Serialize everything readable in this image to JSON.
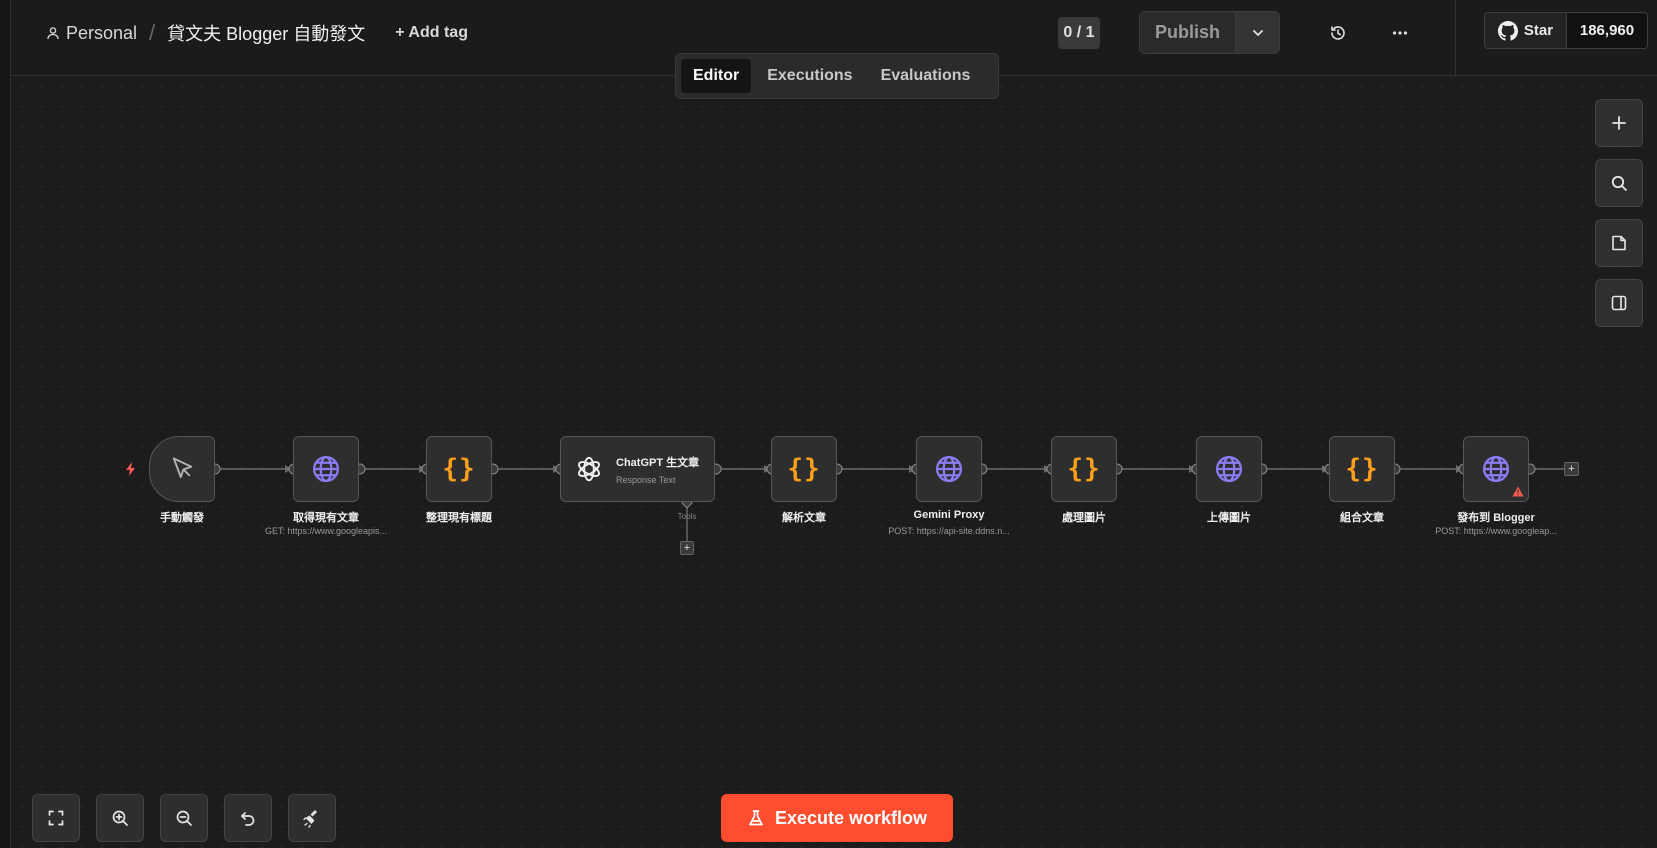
{
  "header": {
    "project": "Personal",
    "workflow_title": "貸文夫 Blogger 自動發文",
    "add_tag": "+ Add tag",
    "counter": "0 / 1",
    "publish": "Publish",
    "github_star": "Star",
    "github_count": "186,960"
  },
  "tabs": [
    {
      "label": "Editor",
      "active": true
    },
    {
      "label": "Executions",
      "active": false
    },
    {
      "label": "Evaluations",
      "active": false
    }
  ],
  "right_toolbar": [
    "plus-icon",
    "search-icon",
    "sticky-note-icon",
    "panel-icon"
  ],
  "nodes": [
    {
      "label": "手動觸發",
      "sub": "",
      "icon": "cursor-icon"
    },
    {
      "label": "取得現有文章",
      "sub": "GET: https://www.googleapis...",
      "icon": "globe-icon"
    },
    {
      "label": "整理現有標題",
      "sub": "",
      "icon": "code-braces-icon"
    },
    {
      "title": "ChatGPT 生文章",
      "sub": "Response Text",
      "tools_label": "Tools",
      "icon": "openai-icon"
    },
    {
      "label": "解析文章",
      "sub": "",
      "icon": "code-braces-icon"
    },
    {
      "label": "Gemini Proxy",
      "sub": "POST: https://api-site.ddns.n...",
      "icon": "globe-icon"
    },
    {
      "label": "處理圖片",
      "sub": "",
      "icon": "code-braces-icon"
    },
    {
      "label": "上傳圖片",
      "sub": "",
      "icon": "globe-icon"
    },
    {
      "label": "組合文章",
      "sub": "",
      "icon": "code-braces-icon"
    },
    {
      "label": "發布到 Blogger",
      "sub": "POST: https://www.googleap...",
      "icon": "globe-icon",
      "warning": true
    }
  ],
  "braces_glyph": "{}",
  "bottom_toolbar": [
    "fit-view-icon",
    "zoom-in-icon",
    "zoom-out-icon",
    "undo-icon",
    "tidy-up-icon"
  ],
  "execute_button": "Execute workflow",
  "colors": {
    "accent": "#ff4d2e",
    "code": "#ff9e1b",
    "http": "#8b7cf6",
    "warning": "#ff5a4f"
  }
}
